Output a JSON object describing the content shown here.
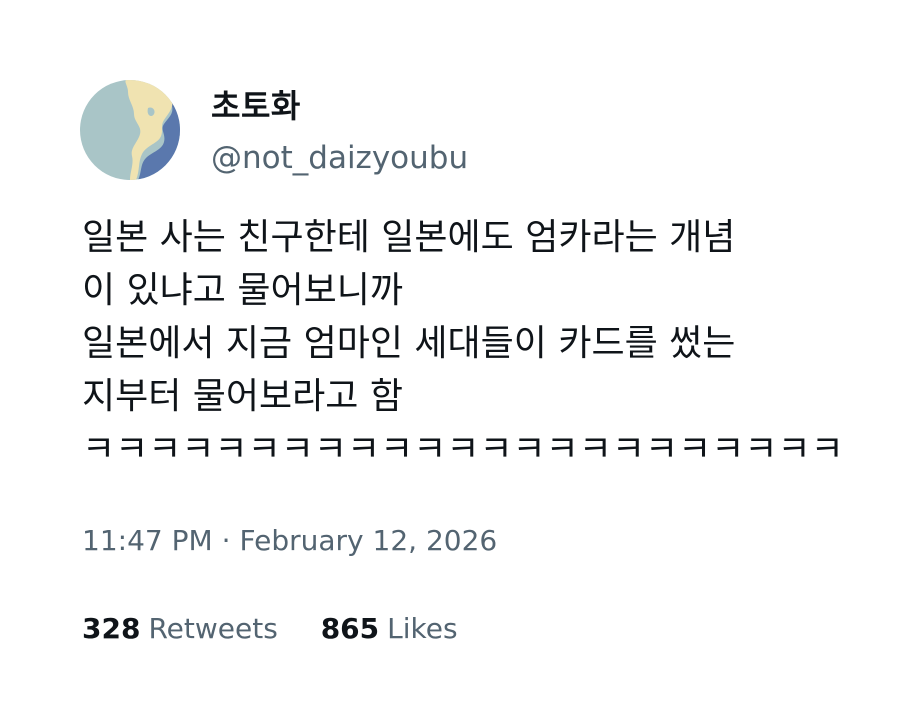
{
  "author": {
    "display_name": "초토화",
    "handle": "@not_daizyoubu",
    "avatar_icon": "globe-map-avatar"
  },
  "tweet": {
    "lines": [
      "일본 사는 친구한테 일본에도 엄카라는 개념",
      "이 있냐고 물어보니까",
      "일본에서 지금 엄마인 세대들이 카드를 썼는",
      "지부터 물어보라고 함",
      "ㅋㅋㅋㅋㅋㅋㅋㅋㅋㅋㅋㅋㅋㅋㅋㅋㅋㅋㅋㅋㅋㅋㅋ"
    ]
  },
  "meta": {
    "time": "11:47 PM",
    "separator": "·",
    "date": "February 12, 2026"
  },
  "stats": {
    "retweets_count": "328",
    "retweets_label": "Retweets",
    "likes_count": "865",
    "likes_label": "Likes"
  },
  "colors": {
    "text_primary": "#0f1419",
    "text_secondary": "#536471",
    "avatar_sea": "#a9c5c7",
    "avatar_land": "#f0e3b1",
    "avatar_ocean_deep": "#5a78ad"
  }
}
